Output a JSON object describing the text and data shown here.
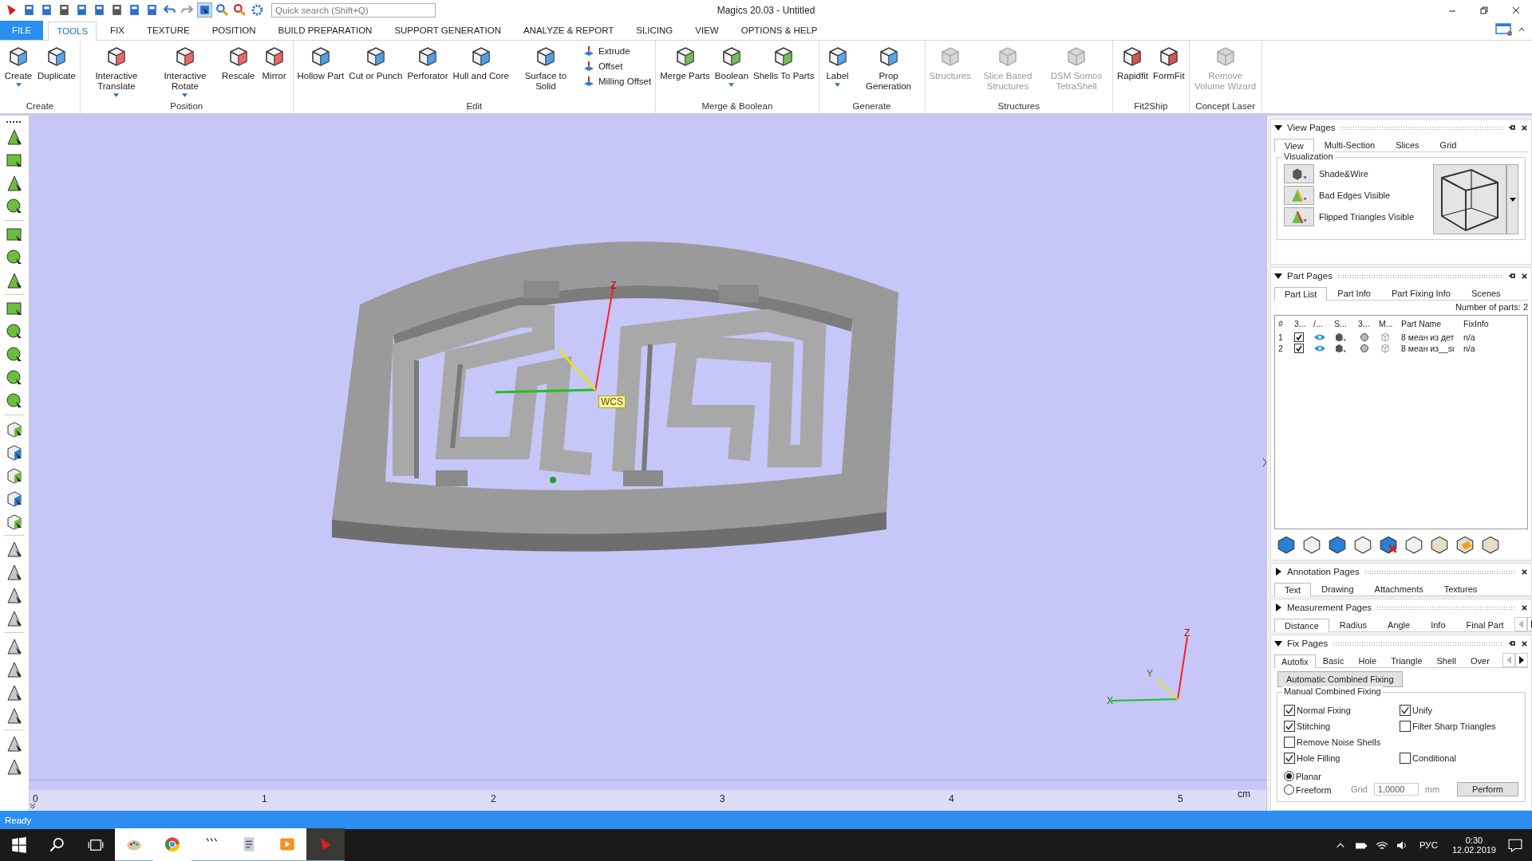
{
  "window": {
    "title": "Magics 20.03 - Untitled"
  },
  "quick_search": {
    "placeholder": "Quick search (Shift+Q)"
  },
  "menu_tabs": [
    {
      "label": "FILE",
      "kind": "file",
      "selected": false
    },
    {
      "label": "TOOLS",
      "kind": "tab",
      "selected": true
    },
    {
      "label": "FIX",
      "kind": "tab",
      "selected": false
    },
    {
      "label": "TEXTURE",
      "kind": "tab",
      "selected": false
    },
    {
      "label": "POSITION",
      "kind": "tab",
      "selected": false
    },
    {
      "label": "BUILD PREPARATION",
      "kind": "tab",
      "selected": false
    },
    {
      "label": "SUPPORT GENERATION",
      "kind": "tab",
      "selected": false
    },
    {
      "label": "ANALYZE & REPORT",
      "kind": "tab",
      "selected": false
    },
    {
      "label": "SLICING",
      "kind": "tab",
      "selected": false
    },
    {
      "label": "VIEW",
      "kind": "tab",
      "selected": false
    },
    {
      "label": "OPTIONS & HELP",
      "kind": "tab",
      "selected": false
    }
  ],
  "ribbon": {
    "groups": [
      {
        "label": "Create",
        "items": [
          {
            "label": "Create",
            "kind": "large",
            "dropdown": true,
            "disabled": false
          },
          {
            "label": "Duplicate",
            "kind": "large",
            "dropdown": false,
            "disabled": false
          }
        ]
      },
      {
        "label": "Position",
        "items": [
          {
            "label": "Interactive Translate",
            "kind": "large",
            "dropdown": true,
            "disabled": false
          },
          {
            "label": "Interactive Rotate",
            "kind": "large",
            "dropdown": true,
            "disabled": false
          },
          {
            "label": "Rescale",
            "kind": "large",
            "dropdown": false,
            "disabled": false
          },
          {
            "label": "Mirror",
            "kind": "large",
            "dropdown": false,
            "disabled": false
          }
        ]
      },
      {
        "label": "Edit",
        "items": [
          {
            "label": "Hollow Part",
            "kind": "large",
            "dropdown": false,
            "disabled": false
          },
          {
            "label": "Cut or Punch",
            "kind": "large",
            "dropdown": false,
            "disabled": false
          },
          {
            "label": "Perforator",
            "kind": "large",
            "dropdown": false,
            "disabled": false
          },
          {
            "label": "Hull and Core",
            "kind": "large",
            "dropdown": false,
            "disabled": false
          },
          {
            "label": "Surface to Solid",
            "kind": "large",
            "dropdown": false,
            "disabled": false
          },
          {
            "label": "Extrude",
            "kind": "small",
            "dropdown": false,
            "disabled": false
          },
          {
            "label": "Offset",
            "kind": "small",
            "dropdown": false,
            "disabled": false
          },
          {
            "label": "Milling Offset",
            "kind": "small",
            "dropdown": false,
            "disabled": false
          }
        ]
      },
      {
        "label": "Merge & Boolean",
        "items": [
          {
            "label": "Merge Parts",
            "kind": "large",
            "dropdown": false,
            "disabled": false
          },
          {
            "label": "Boolean",
            "kind": "large",
            "dropdown": true,
            "disabled": false
          },
          {
            "label": "Shells To Parts",
            "kind": "large",
            "dropdown": false,
            "disabled": false
          }
        ]
      },
      {
        "label": "Generate",
        "items": [
          {
            "label": "Label",
            "kind": "large",
            "dropdown": true,
            "disabled": false
          },
          {
            "label": "Prop Generation",
            "kind": "large",
            "dropdown": false,
            "disabled": false
          }
        ]
      },
      {
        "label": "Structures",
        "items": [
          {
            "label": "Structures",
            "kind": "large",
            "dropdown": false,
            "disabled": true
          },
          {
            "label": "Slice Based Structures",
            "kind": "large",
            "dropdown": false,
            "disabled": true
          },
          {
            "label": "DSM Somos TetraShell",
            "kind": "large",
            "dropdown": false,
            "disabled": true
          }
        ]
      },
      {
        "label": "Fit2Ship",
        "items": [
          {
            "label": "Rapidfit",
            "kind": "large",
            "dropdown": false,
            "disabled": false
          },
          {
            "label": "FormFit",
            "kind": "large",
            "dropdown": false,
            "disabled": false
          }
        ]
      },
      {
        "label": "Concept Laser",
        "items": [
          {
            "label": "Remove Volume Wizard",
            "kind": "large",
            "dropdown": false,
            "disabled": true
          }
        ]
      }
    ]
  },
  "viewport": {
    "wcs_label": "WCS",
    "axis_label": "Z",
    "triad": [
      "Z",
      "Y",
      "X"
    ],
    "ruler": {
      "ticks": [
        "0",
        "1",
        "2",
        "3",
        "4",
        "5"
      ],
      "unit": "cm"
    }
  },
  "view_pages": {
    "title": "View Pages",
    "expanded": true,
    "tabs": [
      {
        "label": "View",
        "selected": true
      },
      {
        "label": "Multi-Section",
        "selected": false
      },
      {
        "label": "Slices",
        "selected": false
      },
      {
        "label": "Grid",
        "selected": false
      }
    ],
    "group": "Visualization",
    "options": [
      "Shade&Wire",
      "Bad Edges Visible",
      "Flipped Triangles Visible"
    ]
  },
  "part_pages": {
    "title": "Part Pages",
    "expanded": true,
    "tabs": [
      {
        "label": "Part List",
        "selected": true
      },
      {
        "label": "Part Info",
        "selected": false
      },
      {
        "label": "Part Fixing Info",
        "selected": false
      },
      {
        "label": "Scenes",
        "selected": false
      }
    ],
    "count": "Number of parts: 2",
    "columns": [
      "#",
      "3...",
      "/...",
      "S...",
      "3...",
      "M...",
      "Part Name",
      "FixInfo"
    ],
    "rows": [
      {
        "num": "1",
        "checked": true,
        "visible": true,
        "name": "8 меан из дет",
        "fixinfo": "n/a"
      },
      {
        "num": "2",
        "checked": true,
        "visible": true,
        "name": "8 меан из__sι",
        "fixinfo": "n/a"
      }
    ]
  },
  "annotation_pages": {
    "title": "Annotation Pages",
    "expanded": false,
    "tabs": [
      {
        "label": "Text",
        "selected": true
      },
      {
        "label": "Drawing",
        "selected": false
      },
      {
        "label": "Attachments",
        "selected": false
      },
      {
        "label": "Textures",
        "selected": false
      }
    ]
  },
  "measurement_pages": {
    "title": "Measurement Pages",
    "expanded": false,
    "scroll_arrows": true,
    "tabs": [
      {
        "label": "Distance",
        "selected": true
      },
      {
        "label": "Radius",
        "selected": false
      },
      {
        "label": "Angle",
        "selected": false
      },
      {
        "label": "Info",
        "selected": false
      },
      {
        "label": "Final Part",
        "selected": false
      }
    ]
  },
  "fix_pages": {
    "title": "Fix Pages",
    "expanded": true,
    "scroll_arrows": true,
    "tabs": [
      {
        "label": "Autofix",
        "selected": true
      },
      {
        "label": "Basic",
        "selected": false
      },
      {
        "label": "Hole",
        "selected": false
      },
      {
        "label": "Triangle",
        "selected": false
      },
      {
        "label": "Shell",
        "selected": false
      },
      {
        "label": "Over",
        "selected": false
      }
    ],
    "button": "Automatic Combined Fixing",
    "group": "Manual Combined Fixing",
    "check_rows": [
      {
        "items": [
          {
            "label": "Normal Fixing",
            "checked": true
          },
          {
            "label": "Unify",
            "checked": true
          }
        ]
      },
      {
        "items": [
          {
            "label": "Stitching",
            "checked": true
          },
          {
            "label": "Filter Sharp Triangles",
            "checked": false
          }
        ]
      },
      {
        "items": [
          {
            "label": "Remove Noise Shells",
            "checked": false
          }
        ]
      },
      {
        "items": [
          {
            "label": "Hole Filling",
            "checked": true
          },
          {
            "label": "Conditional",
            "checked": false
          }
        ]
      }
    ],
    "radios": [
      {
        "label": "Planar",
        "selected": true
      },
      {
        "label": "Freeform",
        "selected": false
      }
    ],
    "grid_label": "Grid",
    "grid_value": "1,0000",
    "unit": "mm",
    "perform": "Perform"
  },
  "status_bar": {
    "text": "Ready"
  },
  "taskbar": {
    "language": "РУС",
    "time": "0:30",
    "date": "12.02.2019"
  }
}
